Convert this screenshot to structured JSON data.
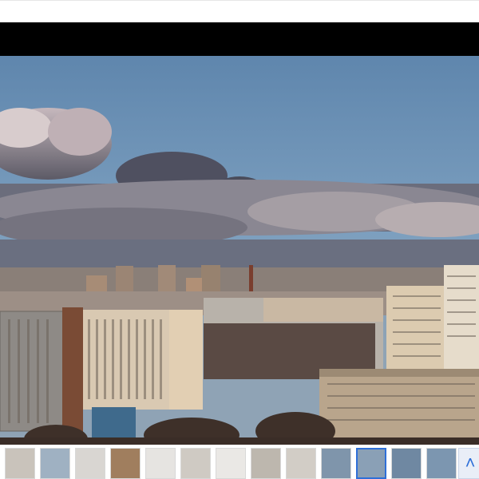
{
  "viewer": {
    "image_subject": "city-skyline-photo"
  },
  "thumbnails": [
    {
      "name": "thumb-1",
      "kind": "interior",
      "color": "#c9c3bb"
    },
    {
      "name": "thumb-2",
      "kind": "window-view",
      "color": "#9fb1c2"
    },
    {
      "name": "thumb-3",
      "kind": "interior",
      "color": "#d9d6d2"
    },
    {
      "name": "thumb-4",
      "kind": "door",
      "color": "#a07e5e"
    },
    {
      "name": "thumb-5",
      "kind": "bathroom",
      "color": "#e6e4e1"
    },
    {
      "name": "thumb-6",
      "kind": "interior",
      "color": "#cfcac3"
    },
    {
      "name": "thumb-7",
      "kind": "bathroom",
      "color": "#eae8e5"
    },
    {
      "name": "thumb-8",
      "kind": "interior",
      "color": "#bdb7ae"
    },
    {
      "name": "thumb-9",
      "kind": "interior",
      "color": "#d2cdc6"
    },
    {
      "name": "thumb-10",
      "kind": "city-view",
      "color": "#7f95ab"
    },
    {
      "name": "thumb-11",
      "kind": "city-view",
      "color": "#8aa0b6"
    },
    {
      "name": "thumb-12",
      "kind": "city-view",
      "color": "#6f88a2"
    },
    {
      "name": "thumb-13",
      "kind": "city-view",
      "color": "#7c96b0"
    },
    {
      "name": "thumb-14",
      "kind": "floor-plan",
      "color": "#eef2f7"
    }
  ],
  "icons": {
    "next": "chevron-up-icon"
  }
}
